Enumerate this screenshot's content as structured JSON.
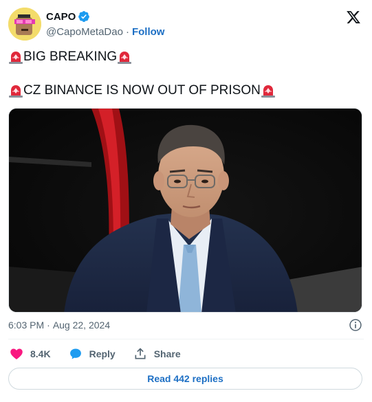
{
  "author": {
    "name": "CAPO",
    "handle": "@CapoMetaDao",
    "separator": "·",
    "follow_label": "Follow"
  },
  "tweet": {
    "line1": "BIG BREAKING",
    "line2": "CZ BINANCE IS NOW OUT OF PRISON",
    "emoji_icon": "police-siren"
  },
  "meta": {
    "time": "6:03 PM",
    "separator": "·",
    "date": "Aug 22, 2024"
  },
  "actions": {
    "likes": "8.4K",
    "reply_label": "Reply",
    "share_label": "Share"
  },
  "footer": {
    "read_replies_label": "Read 442 replies"
  },
  "colors": {
    "accent": "#1d6fc4",
    "like": "#f91880",
    "muted": "#536471",
    "verified": "#1d9bf0"
  }
}
